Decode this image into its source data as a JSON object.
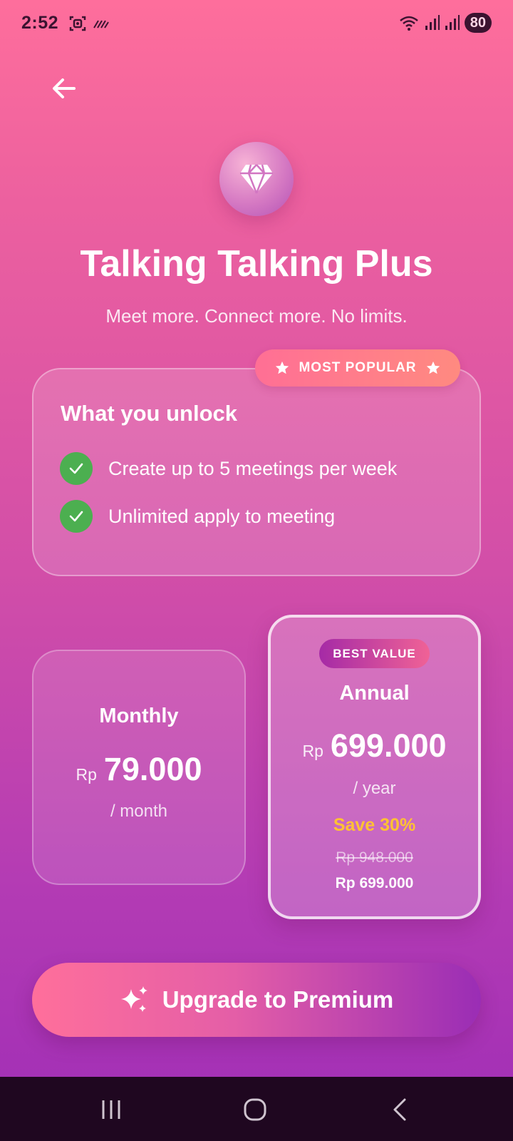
{
  "status_bar": {
    "time": "2:52",
    "icons_left": [
      "screenshot-icon",
      "notification-icon"
    ],
    "icons_right": [
      "wifi-icon",
      "signal-icon",
      "signal-icon"
    ],
    "battery": "80"
  },
  "header": {
    "back_icon": "arrow-left-icon",
    "gem_icon": "diamond-icon",
    "title": "Talking Talking Plus",
    "subtitle": "Meet more. Connect more. No limits."
  },
  "features": {
    "badge": "MOST POPULAR",
    "title": "What you unlock",
    "items": [
      {
        "label": "Create up to 5 meetings per week"
      },
      {
        "label": "Unlimited apply to meeting"
      }
    ]
  },
  "plans": {
    "monthly": {
      "name": "Monthly",
      "currency": "Rp",
      "amount": "79.000",
      "period": "/ month"
    },
    "annual": {
      "badge": "BEST VALUE",
      "name": "Annual",
      "currency": "Rp",
      "amount": "699.000",
      "period": "/ year",
      "save": "Save 30%",
      "old_price": "Rp 948.000",
      "new_price": "Rp 699.000",
      "selected": true
    }
  },
  "cta": {
    "label": "Upgrade to Premium",
    "icon": "sparkles-icon"
  },
  "nav_bar": {
    "icons": [
      "recent-apps-icon",
      "home-icon",
      "back-icon"
    ]
  },
  "colors": {
    "accent_pink": "#ff6f9b",
    "accent_purple": "#9a2db5",
    "save_yellow": "#ffc233",
    "check_green": "#4caf50"
  }
}
